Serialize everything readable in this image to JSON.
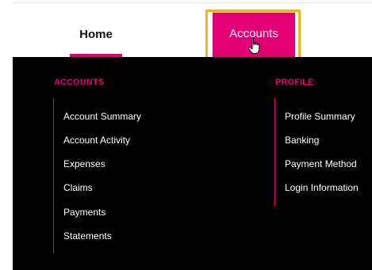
{
  "nav": {
    "tabs": [
      {
        "label": "Home"
      },
      {
        "label": "Accounts"
      }
    ]
  },
  "menu": {
    "accounts": {
      "heading": "ACCOUNTS",
      "items": [
        "Account Summary",
        "Account Activity",
        "Expenses",
        "Claims",
        "Payments",
        "Statements"
      ]
    },
    "profile": {
      "heading": "PROFILE",
      "items": [
        "Profile Summary",
        "Banking",
        "Payment Method",
        "Login Information"
      ]
    }
  },
  "colors": {
    "accent": "#e20074",
    "highlight": "#f0b323",
    "menu_background": "#000000"
  },
  "cursor": {
    "icon": "hand-pointer-icon"
  }
}
